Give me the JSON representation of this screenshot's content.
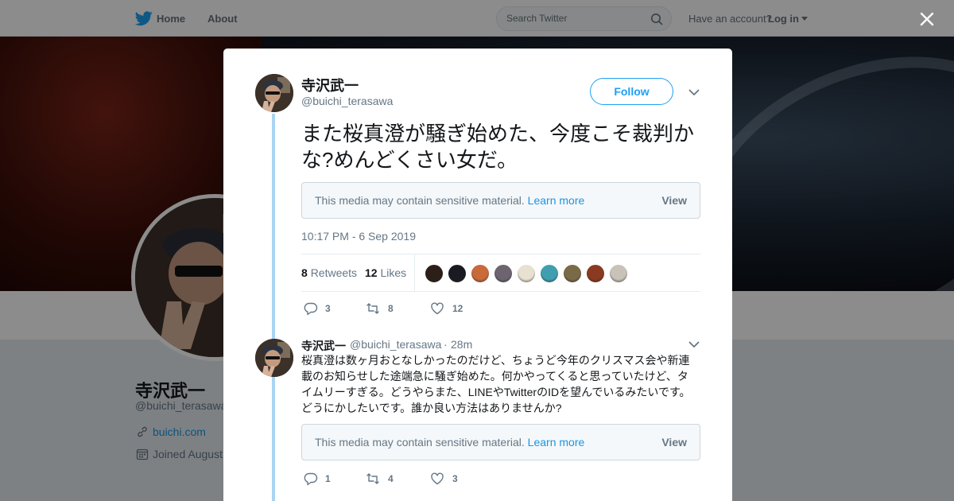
{
  "nav": {
    "home": "Home",
    "about": "About",
    "search_placeholder": "Search Twitter",
    "have_account": "Have an account?",
    "login": "Log in"
  },
  "profile": {
    "name": "寺沢武一",
    "handle": "@buichi_terasawa",
    "website": "buichi.com",
    "joined": "Joined August"
  },
  "tweet": {
    "author_name": "寺沢武一",
    "author_handle": "@buichi_terasawa",
    "follow_label": "Follow",
    "text": "また桜真澄が騒ぎ始めた、今度こそ裁判かな?めんどくさい女だ。",
    "sensitive_message": "This media may contain sensitive material.",
    "learn_more": "Learn more",
    "view": "View",
    "timestamp": "10:17 PM - 6 Sep 2019",
    "retweets_count": "8",
    "retweets_label": "Retweets",
    "likes_count": "12",
    "likes_label": "Likes",
    "liker_colors": [
      "#2b1f18",
      "#1a1a22",
      "#c86a3a",
      "#6d6470",
      "#e8e0d0",
      "#3f9fb0",
      "#7b6a48",
      "#8a3a20",
      "#c9c2b8"
    ],
    "actions": {
      "replies": "3",
      "retweets": "8",
      "likes": "12"
    }
  },
  "reply": {
    "author_name": "寺沢武一",
    "author_handle": "@buichi_terasawa",
    "separator": "·",
    "time": "28m",
    "text": "桜真澄は数ヶ月おとなしかったのだけど、ちょうど今年のクリスマス会や新連載のお知らせした途端急に騒ぎ始めた。何かやってくると思っていたけど、タイムリーすぎる。どうやらまた、LINEやTwitterのIDを望んでいるみたいです。どうにかしたいです。誰か良い方法はありませんか?",
    "sensitive_message": "This media may contain sensitive material.",
    "learn_more": "Learn more",
    "view": "View",
    "actions": {
      "replies": "1",
      "retweets": "4",
      "likes": "3"
    }
  },
  "colors": {
    "accent": "#1da1f2",
    "thread_line": "#aad4f3",
    "secondary_text": "#657786"
  }
}
